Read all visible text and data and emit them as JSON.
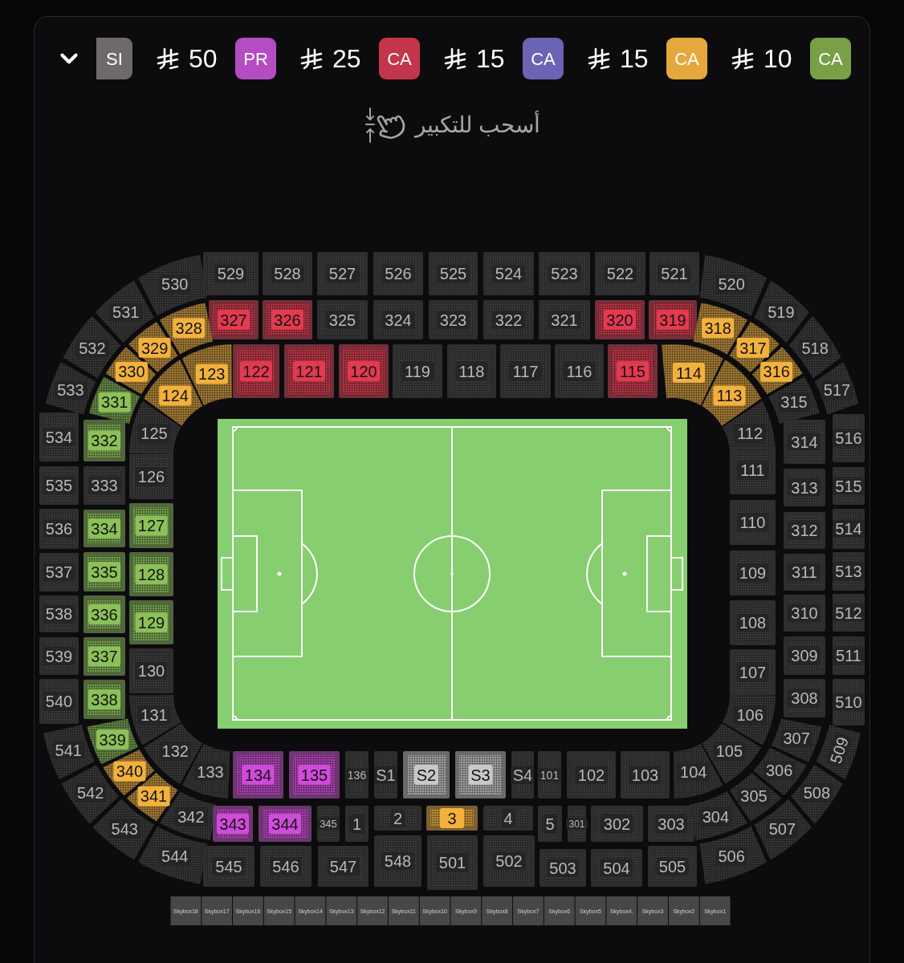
{
  "legend": [
    {
      "code": "SI",
      "color": "#6e6a6a"
    },
    {
      "price": "50",
      "code": "PR",
      "color": "#b54cc2"
    },
    {
      "price": "25",
      "code": "CA",
      "color": "#c3354b"
    },
    {
      "price": "15",
      "code": "CA",
      "color": "#6b63b4"
    },
    {
      "price": "15",
      "code": "CA",
      "color": "#e5a83c"
    },
    {
      "price": "10",
      "code": "CA",
      "color": "#799f47"
    }
  ],
  "hint": "أسحب للتكبير",
  "sections": [
    {
      "label": "529",
      "available": false
    },
    {
      "label": "528",
      "available": false
    },
    {
      "label": "527",
      "available": false
    },
    {
      "label": "526",
      "available": false
    },
    {
      "label": "525",
      "available": false
    },
    {
      "label": "524",
      "available": false
    },
    {
      "label": "523",
      "available": false
    },
    {
      "label": "522",
      "available": false
    },
    {
      "label": "521",
      "available": false
    },
    {
      "label": "327",
      "available": true,
      "color": "#e23a50"
    },
    {
      "label": "326",
      "available": true,
      "color": "#e23a50"
    },
    {
      "label": "325",
      "available": false
    },
    {
      "label": "324",
      "available": false
    },
    {
      "label": "323",
      "available": false
    },
    {
      "label": "322",
      "available": false
    },
    {
      "label": "321",
      "available": false
    },
    {
      "label": "320",
      "available": true,
      "color": "#e23a50"
    },
    {
      "label": "319",
      "available": true,
      "color": "#e23a50"
    },
    {
      "label": "122",
      "available": true,
      "color": "#e23a50"
    },
    {
      "label": "121",
      "available": true,
      "color": "#e23a50"
    },
    {
      "label": "120",
      "available": true,
      "color": "#e23a50"
    },
    {
      "label": "119",
      "available": false
    },
    {
      "label": "118",
      "available": false
    },
    {
      "label": "117",
      "available": false
    },
    {
      "label": "116",
      "available": false
    },
    {
      "label": "115",
      "available": true,
      "color": "#e23a50"
    },
    {
      "label": "520",
      "available": false
    },
    {
      "label": "519",
      "available": false
    },
    {
      "label": "518",
      "available": false
    },
    {
      "label": "517",
      "available": false
    },
    {
      "label": "318",
      "available": true,
      "color": "#f2b13d"
    },
    {
      "label": "317",
      "available": true,
      "color": "#f2b13d"
    },
    {
      "label": "316",
      "available": true,
      "color": "#f2b13d"
    },
    {
      "label": "315",
      "available": false
    },
    {
      "label": "114",
      "available": true,
      "color": "#f2b13d"
    },
    {
      "label": "113",
      "available": true,
      "color": "#f2b13d"
    },
    {
      "label": "112",
      "available": false
    },
    {
      "label": "530",
      "available": false
    },
    {
      "label": "531",
      "available": false
    },
    {
      "label": "532",
      "available": false
    },
    {
      "label": "533",
      "available": false
    },
    {
      "label": "328",
      "available": true,
      "color": "#f2b13d"
    },
    {
      "label": "329",
      "available": true,
      "color": "#f2b13d"
    },
    {
      "label": "330",
      "available": true,
      "color": "#f2b13d"
    },
    {
      "label": "331",
      "available": true,
      "color": "#8bc158"
    },
    {
      "label": "123",
      "available": true,
      "color": "#f2b13d"
    },
    {
      "label": "124",
      "available": true,
      "color": "#f2b13d"
    },
    {
      "label": "125",
      "available": false
    },
    {
      "label": "126",
      "available": false
    },
    {
      "label": "127",
      "available": true,
      "color": "#8bc158"
    },
    {
      "label": "128",
      "available": true,
      "color": "#8bc158"
    },
    {
      "label": "129",
      "available": true,
      "color": "#8bc158"
    },
    {
      "label": "130",
      "available": false
    },
    {
      "label": "332",
      "available": true,
      "color": "#8bc158"
    },
    {
      "label": "333",
      "available": false
    },
    {
      "label": "334",
      "available": true,
      "color": "#8bc158"
    },
    {
      "label": "335",
      "available": true,
      "color": "#8bc158"
    },
    {
      "label": "336",
      "available": true,
      "color": "#8bc158"
    },
    {
      "label": "337",
      "available": true,
      "color": "#8bc158"
    },
    {
      "label": "338",
      "available": true,
      "color": "#8bc158"
    },
    {
      "label": "534",
      "available": false
    },
    {
      "label": "535",
      "available": false
    },
    {
      "label": "536",
      "available": false
    },
    {
      "label": "537",
      "available": false
    },
    {
      "label": "538",
      "available": false
    },
    {
      "label": "539",
      "available": false
    },
    {
      "label": "540",
      "available": false
    },
    {
      "label": "111",
      "available": false
    },
    {
      "label": "110",
      "available": false
    },
    {
      "label": "109",
      "available": false
    },
    {
      "label": "108",
      "available": false
    },
    {
      "label": "107",
      "available": false
    },
    {
      "label": "314",
      "available": false
    },
    {
      "label": "313",
      "available": false
    },
    {
      "label": "312",
      "available": false
    },
    {
      "label": "311",
      "available": false
    },
    {
      "label": "310",
      "available": false
    },
    {
      "label": "309",
      "available": false
    },
    {
      "label": "308",
      "available": false
    },
    {
      "label": "516",
      "available": false
    },
    {
      "label": "515",
      "available": false
    },
    {
      "label": "514",
      "available": false
    },
    {
      "label": "513",
      "available": false
    },
    {
      "label": "512",
      "available": false
    },
    {
      "label": "511",
      "available": false
    },
    {
      "label": "510",
      "available": false
    },
    {
      "label": "133",
      "available": false
    },
    {
      "label": "132",
      "available": false
    },
    {
      "label": "131",
      "available": false
    },
    {
      "label": "342",
      "available": false
    },
    {
      "label": "341",
      "available": true,
      "color": "#f2b13d"
    },
    {
      "label": "340",
      "available": true,
      "color": "#f2b13d"
    },
    {
      "label": "339",
      "available": true,
      "color": "#8bc158"
    },
    {
      "label": "544",
      "available": false
    },
    {
      "label": "543",
      "available": false
    },
    {
      "label": "542",
      "available": false
    },
    {
      "label": "541",
      "available": false
    },
    {
      "label": "134",
      "available": true,
      "color": "#cf4bd9"
    },
    {
      "label": "135",
      "available": true,
      "color": "#cf4bd9"
    },
    {
      "label": "136",
      "available": false
    },
    {
      "label": "S1",
      "available": false
    },
    {
      "label": "S2",
      "available": true,
      "color": "#c8c8c8"
    },
    {
      "label": "S3",
      "available": true,
      "color": "#c8c8c8"
    },
    {
      "label": "S4",
      "available": false
    },
    {
      "label": "101",
      "available": false
    },
    {
      "label": "102",
      "available": false
    },
    {
      "label": "103",
      "available": false
    },
    {
      "label": "343",
      "available": true,
      "color": "#cf4bd9"
    },
    {
      "label": "344",
      "available": true,
      "color": "#cf4bd9"
    },
    {
      "label": "345",
      "available": false
    },
    {
      "label": "1",
      "available": false
    },
    {
      "label": "2",
      "available": false
    },
    {
      "label": "3",
      "available": true,
      "color": "#f2b13d"
    },
    {
      "label": "4",
      "available": false
    },
    {
      "label": "5",
      "available": false
    },
    {
      "label": "301",
      "available": false
    },
    {
      "label": "302",
      "available": false
    },
    {
      "label": "303",
      "available": false
    },
    {
      "label": "545",
      "available": false
    },
    {
      "label": "546",
      "available": false
    },
    {
      "label": "547",
      "available": false
    },
    {
      "label": "548",
      "available": false
    },
    {
      "label": "501",
      "available": false
    },
    {
      "label": "502",
      "available": false
    },
    {
      "label": "503",
      "available": false
    },
    {
      "label": "504",
      "available": false
    },
    {
      "label": "505",
      "available": false
    },
    {
      "label": "104",
      "available": false
    },
    {
      "label": "105",
      "available": false
    },
    {
      "label": "106",
      "available": false
    },
    {
      "label": "304",
      "available": false
    },
    {
      "label": "305",
      "available": false
    },
    {
      "label": "306",
      "available": false
    },
    {
      "label": "307",
      "available": false
    },
    {
      "label": "506",
      "available": false
    },
    {
      "label": "507",
      "available": false
    },
    {
      "label": "508",
      "available": false
    },
    {
      "label": "509",
      "available": false
    }
  ],
  "skyboxes": [
    "Skybox18",
    "Skybox17",
    "Skybox16",
    "Skybox15",
    "Skybox14",
    "Skybox13",
    "Skybox12",
    "Skybox11",
    "Skybox10",
    "Skybox9",
    "Skybox8",
    "Skybox7",
    "Skybox6",
    "Skybox5",
    "Skybox4.",
    "Skybox3",
    "Skybox2",
    "Skybox1"
  ]
}
